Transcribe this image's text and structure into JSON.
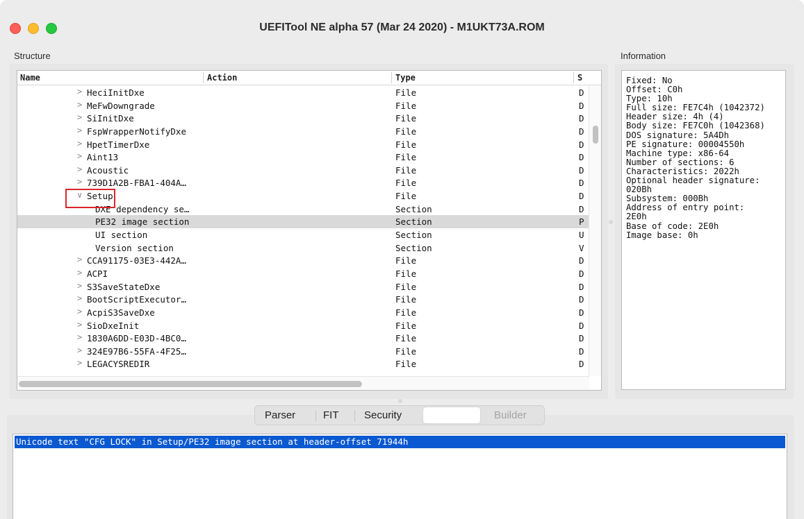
{
  "window": {
    "title": "UEFITool NE alpha 57 (Mar 24 2020) - M1UKT73A.ROM"
  },
  "structure": {
    "label": "Structure",
    "columns": {
      "name": "Name",
      "action": "Action",
      "type": "Type",
      "subtype": "S"
    },
    "rows": [
      {
        "name": "HeciInitDxe",
        "type": "File",
        "subtype": "D",
        "expander": ">",
        "level": 1
      },
      {
        "name": "MeFwDowngrade",
        "type": "File",
        "subtype": "D",
        "expander": ">",
        "level": 1
      },
      {
        "name": "SiInitDxe",
        "type": "File",
        "subtype": "D",
        "expander": ">",
        "level": 1
      },
      {
        "name": "FspWrapperNotifyDxe",
        "type": "File",
        "subtype": "D",
        "expander": ">",
        "level": 1
      },
      {
        "name": "HpetTimerDxe",
        "type": "File",
        "subtype": "D",
        "expander": ">",
        "level": 1
      },
      {
        "name": "Aint13",
        "type": "File",
        "subtype": "D",
        "expander": ">",
        "level": 1
      },
      {
        "name": "Acoustic",
        "type": "File",
        "subtype": "D",
        "expander": ">",
        "level": 1
      },
      {
        "name": "739D1A2B-FBA1-404A…",
        "type": "File",
        "subtype": "D",
        "expander": ">",
        "level": 1
      },
      {
        "name": "Setup",
        "type": "File",
        "subtype": "D",
        "expander": "∨",
        "level": 1
      },
      {
        "name": "DXE dependency se…",
        "type": "Section",
        "subtype": "D",
        "expander": "",
        "level": 2
      },
      {
        "name": "PE32 image section",
        "type": "Section",
        "subtype": "P",
        "expander": "",
        "level": 2,
        "selected": true
      },
      {
        "name": "UI section",
        "type": "Section",
        "subtype": "U",
        "expander": "",
        "level": 2
      },
      {
        "name": "Version section",
        "type": "Section",
        "subtype": "V",
        "expander": "",
        "level": 2
      },
      {
        "name": "CCA91175-03E3-442A…",
        "type": "File",
        "subtype": "D",
        "expander": ">",
        "level": 1
      },
      {
        "name": "ACPI",
        "type": "File",
        "subtype": "D",
        "expander": ">",
        "level": 1
      },
      {
        "name": "S3SaveStateDxe",
        "type": "File",
        "subtype": "D",
        "expander": ">",
        "level": 1
      },
      {
        "name": "BootScriptExecutor…",
        "type": "File",
        "subtype": "D",
        "expander": ">",
        "level": 1
      },
      {
        "name": "AcpiS3SaveDxe",
        "type": "File",
        "subtype": "D",
        "expander": ">",
        "level": 1
      },
      {
        "name": "SioDxeInit",
        "type": "File",
        "subtype": "D",
        "expander": ">",
        "level": 1
      },
      {
        "name": "1830A6DD-E03D-4BC0…",
        "type": "File",
        "subtype": "D",
        "expander": ">",
        "level": 1
      },
      {
        "name": "324E97B6-55FA-4F25…",
        "type": "File",
        "subtype": "D",
        "expander": ">",
        "level": 1
      },
      {
        "name": "LEGACYSREDIR",
        "type": "File",
        "subtype": "D",
        "expander": ">",
        "level": 1
      }
    ]
  },
  "information": {
    "label": "Information",
    "lines": [
      "Fixed: No",
      "Offset: C0h",
      "Type: 10h",
      "Full size: FE7C4h (1042372)",
      "Header size: 4h (4)",
      "Body size: FE7C0h (1042368)",
      "DOS signature: 5A4Dh",
      "PE signature: 00004550h",
      "Machine type: x86-64",
      "Number of sections: 6",
      "Characteristics: 2022h",
      "Optional header signature:",
      "020Bh",
      "Subsystem: 000Bh",
      "Address of entry point:",
      "2E0h",
      "Base of code: 2E0h",
      "Image base: 0h"
    ]
  },
  "tabs": {
    "parser": "Parser",
    "fit": "FIT",
    "security": "Security",
    "search": "",
    "builder": "Builder"
  },
  "messages": [
    "Unicode text \"CFG LOCK\" in Setup/PE32 image section at header-offset 71944h"
  ],
  "colors": {
    "selection": "#0b59d0",
    "highlight_box": "#d9262c",
    "row_selected": "#d9d9d9"
  }
}
